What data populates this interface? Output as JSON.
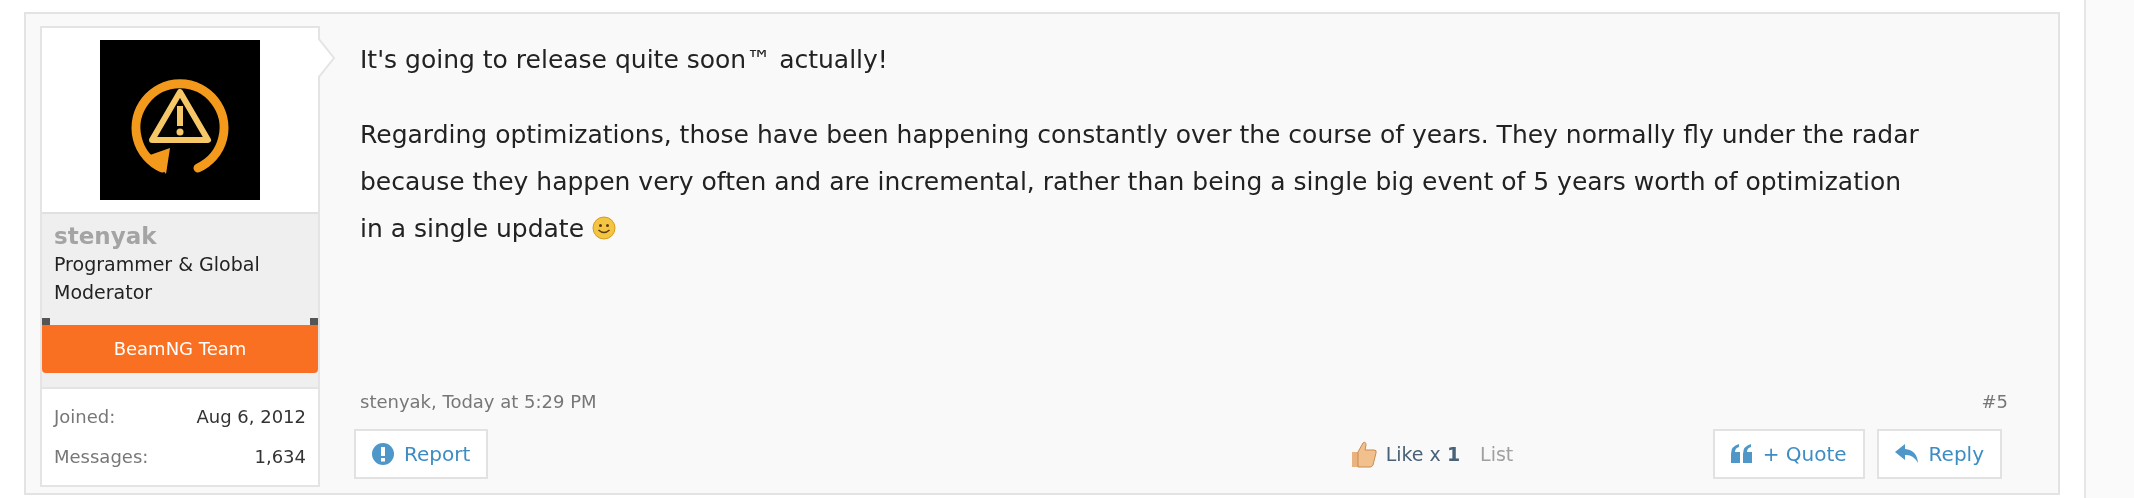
{
  "post": {
    "author": {
      "name": "stenyak",
      "title": "Programmer & Global Moderator",
      "banner": "BeamNG Team",
      "stats": [
        {
          "label": "Joined:",
          "value": "Aug 6, 2012"
        },
        {
          "label": "Messages:",
          "value": "1,634"
        }
      ]
    },
    "message": {
      "paragraphs": [
        {
          "text": "It's going to release quite soon™ actually!",
          "smiley": false
        },
        {
          "text": "Regarding optimizations, those have been happening constantly over the course of years. They normally fly under the radar because they happen very often and are incremental, rather than being a single big event of 5 years worth of optimization in a single update",
          "smiley": true
        }
      ]
    },
    "byline": "stenyak, Today at 5:29 PM",
    "number": "#5",
    "report_button": "Report",
    "likes": {
      "text": "Like x **1**",
      "list_link": "List"
    },
    "quote_button": "+ Quote",
    "reply_button": "Reply"
  }
}
